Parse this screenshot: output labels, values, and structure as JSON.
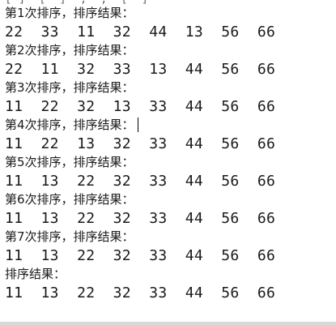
{
  "console": {
    "partial_top_text": "[ ]  [  ]  ,  ,  [  ]",
    "passes": [
      {
        "label": "第1次排序，排序结果：",
        "values": "22  33  11  32  44  13  56  66"
      },
      {
        "label": "第2次排序，排序结果：",
        "values": "22  11  32  33  13  44  56  66"
      },
      {
        "label": "第3次排序，排序结果：",
        "values": "11  22  32  13  33  44  56  66"
      },
      {
        "label": "第4次排序，排序结果：",
        "values": "11  22  13  32  33  44  56  66"
      },
      {
        "label": "第5次排序，排序结果：",
        "values": "11  13  22  32  33  44  56  66"
      },
      {
        "label": "第6次排序，排序结果：",
        "values": "11  13  22  32  33  44  56  66"
      },
      {
        "label": "第7次排序，排序结果：",
        "values": "11  13  22  32  33  44  56  66"
      }
    ],
    "final": {
      "label": "排序结果：",
      "values": "11  13  22  32  33  44  56  66"
    }
  }
}
